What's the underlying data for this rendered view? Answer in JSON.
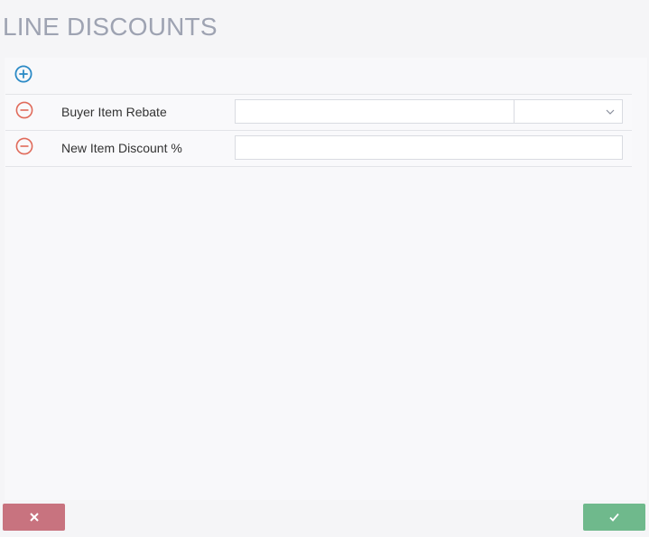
{
  "page": {
    "title": "LINE DISCOUNTS"
  },
  "toolbar": {
    "add_icon": "plus-circle-icon",
    "add_color": "#2b8ac6"
  },
  "rows": [
    {
      "label": "Buyer Item Rebate",
      "value": "",
      "select_value": "",
      "remove_icon": "minus-circle-icon"
    },
    {
      "label": "New Item Discount %",
      "value": "",
      "remove_icon": "minus-circle-icon"
    }
  ],
  "footer": {
    "cancel_icon": "close-icon",
    "cancel_color": "#c8737f",
    "confirm_icon": "check-icon",
    "confirm_color": "#6fb98c"
  },
  "colors": {
    "remove": "#e06a5a",
    "title": "#9ea3b2"
  }
}
